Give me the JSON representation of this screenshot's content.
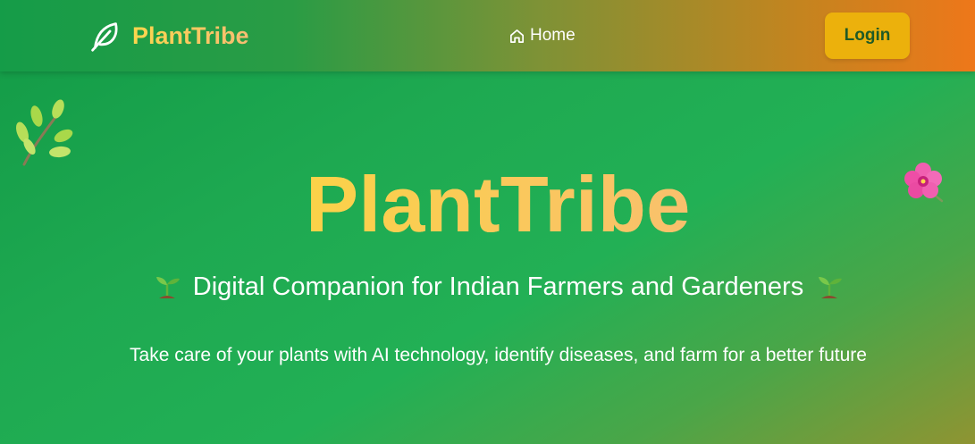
{
  "header": {
    "brand_name": "PlantTribe",
    "brand_icon": "leaf-icon",
    "nav_home_label": "Home",
    "nav_home_icon": "home-icon",
    "login_label": "Login"
  },
  "hero": {
    "title": "PlantTribe",
    "subtitle": "Digital Companion for Indian Farmers and Gardeners",
    "subtitle_icon": "seedling-icon",
    "description": "Take care of your plants with AI technology, identify diseases, and farm for a better future"
  },
  "decorations": {
    "left_icon": "herb-icon",
    "right_icon": "hibiscus-icon"
  },
  "colors": {
    "accent_yellow": "#fcd155",
    "login_button": "#ecb10c",
    "login_text": "#1f5a26",
    "green": "#1ea951",
    "orange": "#ee771a"
  }
}
